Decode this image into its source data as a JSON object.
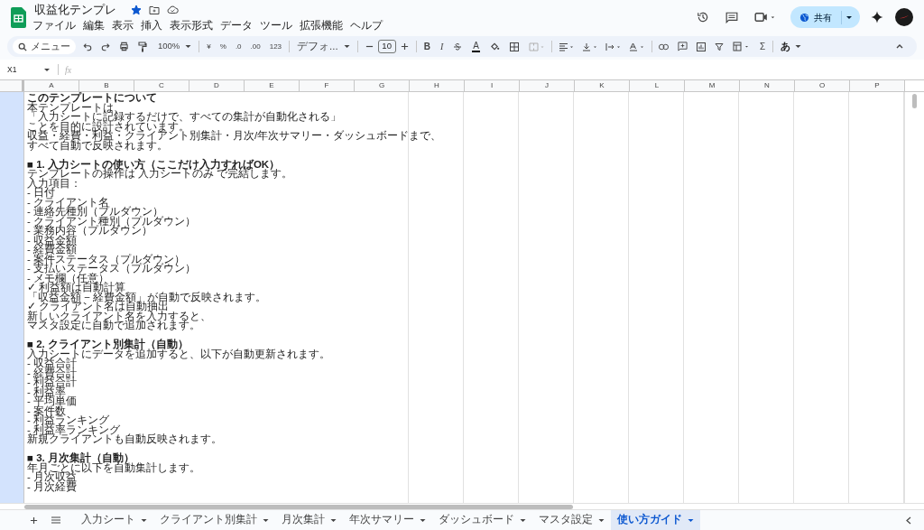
{
  "document": {
    "title": "収益化テンプレ",
    "starred": true
  },
  "menu": [
    "ファイル",
    "編集",
    "表示",
    "挿入",
    "表示形式",
    "データ",
    "ツール",
    "拡張機能",
    "ヘルプ"
  ],
  "share_button": "共有",
  "toolbar": {
    "search": "メニュー",
    "zoom": "100%",
    "currency": "¥",
    "percent": "%",
    "decrease_decimal": ".0",
    "increase_decimal": ".00",
    "number_format": "123",
    "font": "デフォ...",
    "font_size": "10",
    "bold": "B",
    "italic": "I",
    "text_color": "A",
    "functions": "Σ",
    "input_tools": "あ"
  },
  "formula_bar": {
    "cell_ref": "X1",
    "fx": "fx"
  },
  "columns": [
    "A",
    "B",
    "C",
    "D",
    "E",
    "F",
    "G",
    "H",
    "I",
    "J",
    "K",
    "L",
    "M",
    "N",
    "O",
    "P"
  ],
  "guide": [
    {
      "kind": "heading",
      "text": "このテンプレートについて"
    },
    {
      "kind": "text",
      "text": "本テンプレートは、"
    },
    {
      "kind": "text",
      "text": "「入力シートに記録するだけで、すべての集計が自動化される」"
    },
    {
      "kind": "text",
      "text": "ことを目的に設計されています。"
    },
    {
      "kind": "text",
      "text": "収益・経費・利益・クライアント別集計・月次/年次サマリー・ダッシュボードまで、"
    },
    {
      "kind": "text",
      "text": "すべて自動で反映されます。"
    },
    {
      "kind": "blank"
    },
    {
      "kind": "heading",
      "text": "■ 1. 入力シートの使い方（ここだけ入力すればOK）"
    },
    {
      "kind": "text",
      "text": "テンプレートの操作は 入力シートのみ で完結します。"
    },
    {
      "kind": "text",
      "text": "入力項目："
    },
    {
      "kind": "text",
      "text": "- 日付"
    },
    {
      "kind": "text",
      "text": "- クライアント名"
    },
    {
      "kind": "text",
      "text": "- 連絡先種別（プルダウン）"
    },
    {
      "kind": "text",
      "text": "- クライアント種別（プルダウン）"
    },
    {
      "kind": "text",
      "text": "- 業務内容（プルダウン）"
    },
    {
      "kind": "text",
      "text": "- 収益金額"
    },
    {
      "kind": "text",
      "text": "- 経費金額"
    },
    {
      "kind": "text",
      "text": "- 案件ステータス（プルダウン）"
    },
    {
      "kind": "text",
      "text": "- 支払いステータス（プルダウン）"
    },
    {
      "kind": "text",
      "text": "- メモ欄（任意）"
    },
    {
      "kind": "text",
      "text": "✓ 利益額は自動計算"
    },
    {
      "kind": "text",
      "text": "「収益金額 − 経費金額」が自動で反映されます。"
    },
    {
      "kind": "text",
      "text": "✓ クライアント名は自動抽出"
    },
    {
      "kind": "text",
      "text": "新しいクライアント名を入力すると、"
    },
    {
      "kind": "text",
      "text": "マスタ設定に自動で追加されます。"
    },
    {
      "kind": "blank"
    },
    {
      "kind": "heading",
      "text": "■ 2. クライアント別集計（自動）"
    },
    {
      "kind": "text",
      "text": "入力シートにデータを追加すると、以下が自動更新されます。"
    },
    {
      "kind": "text",
      "text": "- 収益合計"
    },
    {
      "kind": "text",
      "text": "- 経費合計"
    },
    {
      "kind": "text",
      "text": "- 利益合計"
    },
    {
      "kind": "text",
      "text": "- 利益率"
    },
    {
      "kind": "text",
      "text": "- 平均単価"
    },
    {
      "kind": "text",
      "text": "- 案件数"
    },
    {
      "kind": "text",
      "text": "- 利益ランキング"
    },
    {
      "kind": "text",
      "text": "- 利益率ランキング"
    },
    {
      "kind": "text",
      "text": "新規クライアントも自動反映されます。"
    },
    {
      "kind": "blank"
    },
    {
      "kind": "heading",
      "text": "■ 3. 月次集計（自動）"
    },
    {
      "kind": "text",
      "text": "年月ごとに以下を自動集計します。"
    },
    {
      "kind": "text",
      "text": "- 月次収益"
    },
    {
      "kind": "text",
      "text": "- 月次経費"
    }
  ],
  "sheet_tabs": [
    {
      "label": "入力シート",
      "selected": false
    },
    {
      "label": "クライアント別集計",
      "selected": false
    },
    {
      "label": "月次集計",
      "selected": false
    },
    {
      "label": "年次サマリー",
      "selected": false
    },
    {
      "label": "ダッシュボード",
      "selected": false
    },
    {
      "label": "マスタ設定",
      "selected": false
    },
    {
      "label": "使い方ガイド",
      "selected": true
    }
  ]
}
